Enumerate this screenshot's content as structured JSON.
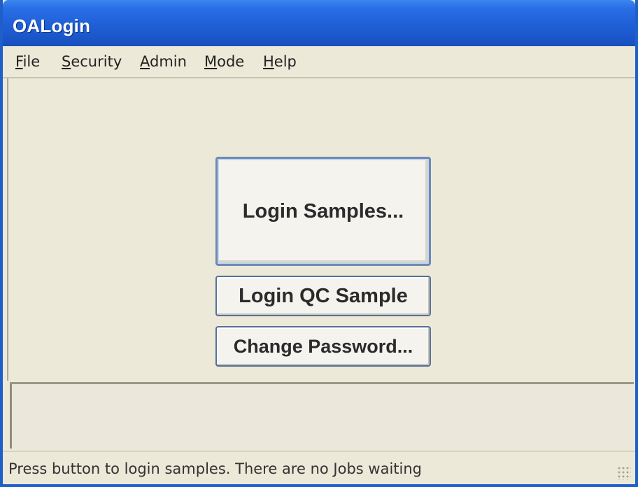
{
  "window": {
    "title": "OALogin"
  },
  "menu": {
    "items": [
      {
        "mnemonic": "F",
        "rest": "ile"
      },
      {
        "mnemonic": "S",
        "rest": "ecurity"
      },
      {
        "mnemonic": "A",
        "rest": "dmin"
      },
      {
        "mnemonic": "M",
        "rest": "ode"
      },
      {
        "mnemonic": "H",
        "rest": "elp"
      }
    ]
  },
  "buttons": {
    "login_samples": "Login Samples...",
    "login_qc_sample": "Login QC Sample",
    "change_password": "Change Password..."
  },
  "message_panel": {
    "text": ""
  },
  "status": {
    "text": "Press button to login samples. There are no Jobs waiting"
  },
  "colors": {
    "titlebar": "#1f5fd6",
    "window_bg": "#ece9d8",
    "button_border": "#56709a"
  },
  "icons": {
    "resize_grip": "resize-grip-icon"
  }
}
